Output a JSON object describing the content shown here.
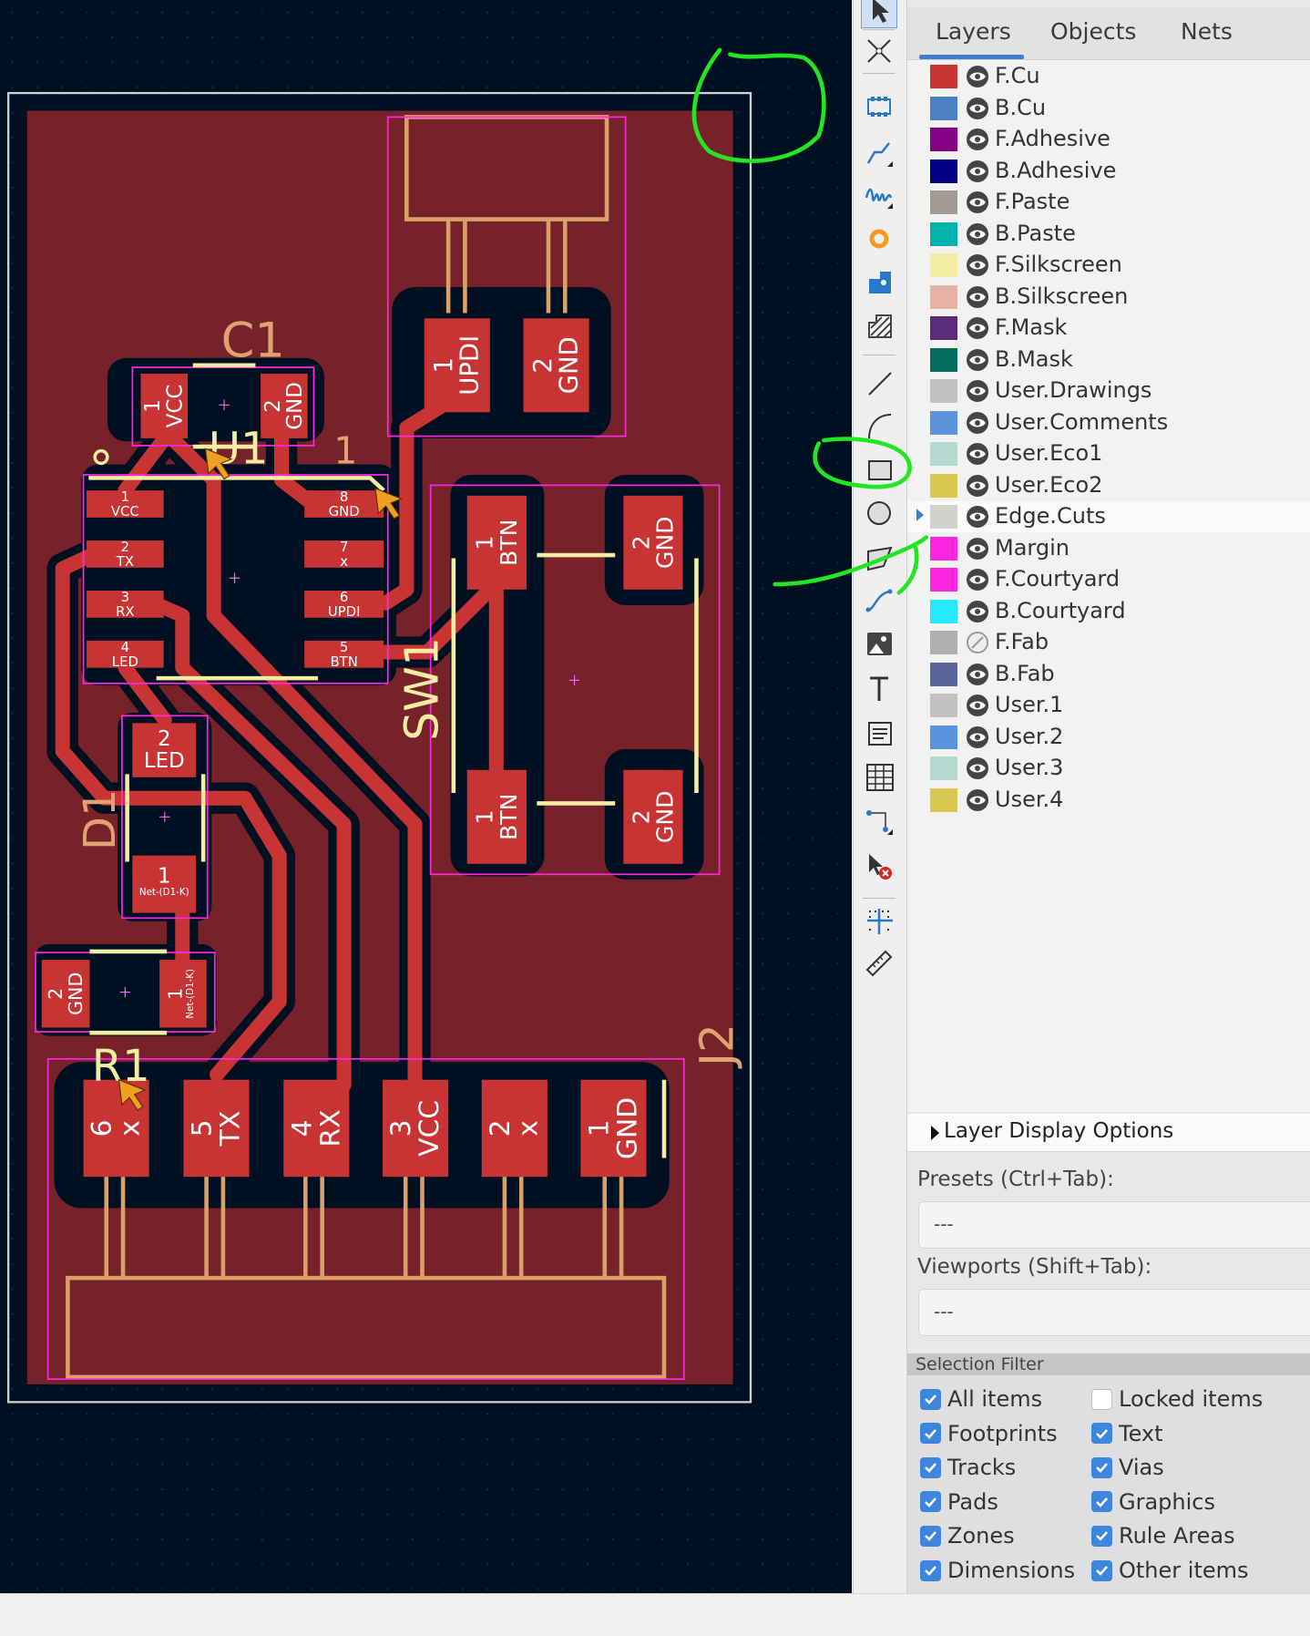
{
  "colors": {
    "canvas_bg": "#001023",
    "copper": "#c83434",
    "zone": "#772228",
    "silkscreen": "#f2eda1",
    "courtyard": "#ff26e2",
    "fab": "#d9a06a",
    "edge": "#d0d2cd",
    "annotation": "#22e622",
    "accent": "#3d86dd"
  },
  "toolbar": {
    "tools": [
      "select-arrow",
      "local-ratsnest",
      "add-footprint",
      "route-track",
      "tune-length",
      "add-via",
      "add-pad",
      "add-zone",
      "draw-line",
      "draw-arc",
      "draw-rectangle",
      "draw-circle",
      "draw-polygon",
      "draw-bezier",
      "add-image",
      "add-text",
      "add-textbox",
      "add-table",
      "add-dimension",
      "delete-tool",
      "grid-origin",
      "measure"
    ]
  },
  "panel": {
    "tabs": [
      {
        "label": "Layers",
        "active": true
      },
      {
        "label": "Objects",
        "active": false
      },
      {
        "label": "Nets",
        "active": false
      }
    ],
    "layers": [
      {
        "name": "F.Cu",
        "color": "#c83434",
        "visible": true
      },
      {
        "name": "B.Cu",
        "color": "#4d7fc4",
        "visible": true
      },
      {
        "name": "F.Adhesive",
        "color": "#840084",
        "visible": true
      },
      {
        "name": "B.Adhesive",
        "color": "#000084",
        "visible": true
      },
      {
        "name": "F.Paste",
        "color": "#a29a93",
        "visible": true
      },
      {
        "name": "B.Paste",
        "color": "#00b3ad",
        "visible": true
      },
      {
        "name": "F.Silkscreen",
        "color": "#f2eda1",
        "visible": true
      },
      {
        "name": "B.Silkscreen",
        "color": "#e8b2a7",
        "visible": true
      },
      {
        "name": "F.Mask",
        "color": "#5a2d7a",
        "visible": true
      },
      {
        "name": "B.Mask",
        "color": "#046b5f",
        "visible": true
      },
      {
        "name": "User.Drawings",
        "color": "#c2c2c2",
        "visible": true
      },
      {
        "name": "User.Comments",
        "color": "#5994dc",
        "visible": true
      },
      {
        "name": "User.Eco1",
        "color": "#b4dbd2",
        "visible": true
      },
      {
        "name": "User.Eco2",
        "color": "#d8c852",
        "visible": true
      },
      {
        "name": "Edge.Cuts",
        "color": "#d0d2cd",
        "visible": true,
        "selected": true
      },
      {
        "name": "Margin",
        "color": "#ff26e2",
        "visible": true
      },
      {
        "name": "F.Courtyard",
        "color": "#ff26e2",
        "visible": true
      },
      {
        "name": "B.Courtyard",
        "color": "#26e9ff",
        "visible": true
      },
      {
        "name": "F.Fab",
        "color": "#afafaf",
        "visible": false
      },
      {
        "name": "B.Fab",
        "color": "#58649c",
        "visible": true
      },
      {
        "name": "User.1",
        "color": "#c2c2c2",
        "visible": true
      },
      {
        "name": "User.2",
        "color": "#5994dc",
        "visible": true
      },
      {
        "name": "User.3",
        "color": "#b4dbd2",
        "visible": true
      },
      {
        "name": "User.4",
        "color": "#d8c852",
        "visible": true
      }
    ],
    "layer_display_options": "Layer Display Options",
    "presets_label": "Presets (Ctrl+Tab):",
    "presets_value": "---",
    "viewports_label": "Viewports (Shift+Tab):",
    "viewports_value": "---",
    "selection_filter": {
      "title": "Selection Filter",
      "items": [
        {
          "label": "All items",
          "checked": true
        },
        {
          "label": "Locked items",
          "checked": false
        },
        {
          "label": "Footprints",
          "checked": true
        },
        {
          "label": "Text",
          "checked": true
        },
        {
          "label": "Tracks",
          "checked": true
        },
        {
          "label": "Vias",
          "checked": true
        },
        {
          "label": "Pads",
          "checked": true
        },
        {
          "label": "Graphics",
          "checked": true
        },
        {
          "label": "Zones",
          "checked": true
        },
        {
          "label": "Rule Areas",
          "checked": true
        },
        {
          "label": "Dimensions",
          "checked": true
        },
        {
          "label": "Other items",
          "checked": true
        }
      ]
    }
  },
  "pcb": {
    "refs": {
      "c1": "C1",
      "u1": "U1",
      "sw1": "SW1",
      "d1": "D1",
      "r1": "R1",
      "j2": "J2",
      "u1_pin1": "1"
    },
    "pads": [
      {
        "num": "1",
        "net": "UPDI"
      },
      {
        "num": "2",
        "net": "GND"
      },
      {
        "num": "1",
        "net": "VCC"
      },
      {
        "num": "2",
        "net": "GND"
      },
      {
        "num": "1",
        "net": "VCC"
      },
      {
        "num": "2",
        "net": "TX"
      },
      {
        "num": "3",
        "net": "RX"
      },
      {
        "num": "4",
        "net": "LED"
      },
      {
        "num": "8",
        "net": "GND"
      },
      {
        "num": "7",
        "net": "x"
      },
      {
        "num": "6",
        "net": "UPDI"
      },
      {
        "num": "5",
        "net": "BTN"
      },
      {
        "num": "1",
        "net": "BTN"
      },
      {
        "num": "2",
        "net": "GND"
      },
      {
        "num": "1",
        "net": "BTN"
      },
      {
        "num": "2",
        "net": "GND"
      },
      {
        "num": "2",
        "net": "LED"
      },
      {
        "num": "1",
        "net": "Net-(D1-K)"
      },
      {
        "num": "2",
        "net": "GND"
      },
      {
        "num": "1",
        "net": "Net-(D1-K)"
      },
      {
        "num": "6",
        "net": "x"
      },
      {
        "num": "5",
        "net": "TX"
      },
      {
        "num": "4",
        "net": "RX"
      },
      {
        "num": "3",
        "net": "VCC"
      },
      {
        "num": "2",
        "net": "x"
      },
      {
        "num": "1",
        "net": "GND"
      }
    ]
  }
}
